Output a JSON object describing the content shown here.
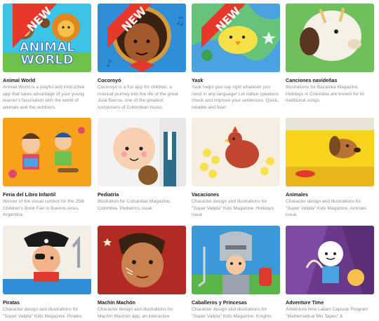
{
  "cards": [
    {
      "title": "Animal World",
      "desc": "Animal World is a playful and instructive app that takes advantage of your young learner's fascination with the world of animals and the outdoors.",
      "badge": "NEW",
      "logo_line1": "ANIMAL",
      "logo_line2": "WORLD"
    },
    {
      "title": "Cocoroyó",
      "desc": "Cocoroyó is a fun app for children, a musical journey into the life of the great José Barros, one of the greatest composers of Colombian music.",
      "badge": "NEW"
    },
    {
      "title": "Yask",
      "desc": "Yask helps you say right whatever you need in any language! Let native speakers check and improve your sentences. Quick, reliable and free!",
      "badge": "NEW"
    },
    {
      "title": "Canciones navideñas",
      "desc": "Illustrations for Bacánika Magazine. Holidays in Colombia are known for its traditional songs."
    },
    {
      "title": "Feria del Libro Infantil",
      "desc": "Winner of the visual contest for the 25th Children's Book Fair in Buenos Aires, Argentina."
    },
    {
      "title": "Pediatría",
      "desc": "Illustration for Colsanitas Magazine, Colombia. Pediatrics issue."
    },
    {
      "title": "Vacaciones",
      "desc": "Character design and illustrations for \"Super Valijita\" Kids Magazine. Holidays issue."
    },
    {
      "title": "Animales",
      "desc": "Character design and illustrations for \"Super Valijita\" Kids Magazine. Animals issue."
    },
    {
      "title": "Piratas",
      "desc": "Character design and illustrations for \"Super Valijita\" Kids Magazine. Pirates"
    },
    {
      "title": "Machín Machón",
      "desc": "Character design and illustrations for Machín Machón app, an interactive"
    },
    {
      "title": "Caballeros y Princesas",
      "desc": "Character design and illustrations for \"Super Valijita\" Kids Magazine. Knights"
    },
    {
      "title": "Adventure Time",
      "desc": "Adventure time Latam Capsule Program \"Mathematical Mix Tapes\" &"
    }
  ],
  "colors": {
    "ribbon": "#e8372b",
    "title": "#1b1b1b",
    "desc": "#8e8e8e"
  }
}
